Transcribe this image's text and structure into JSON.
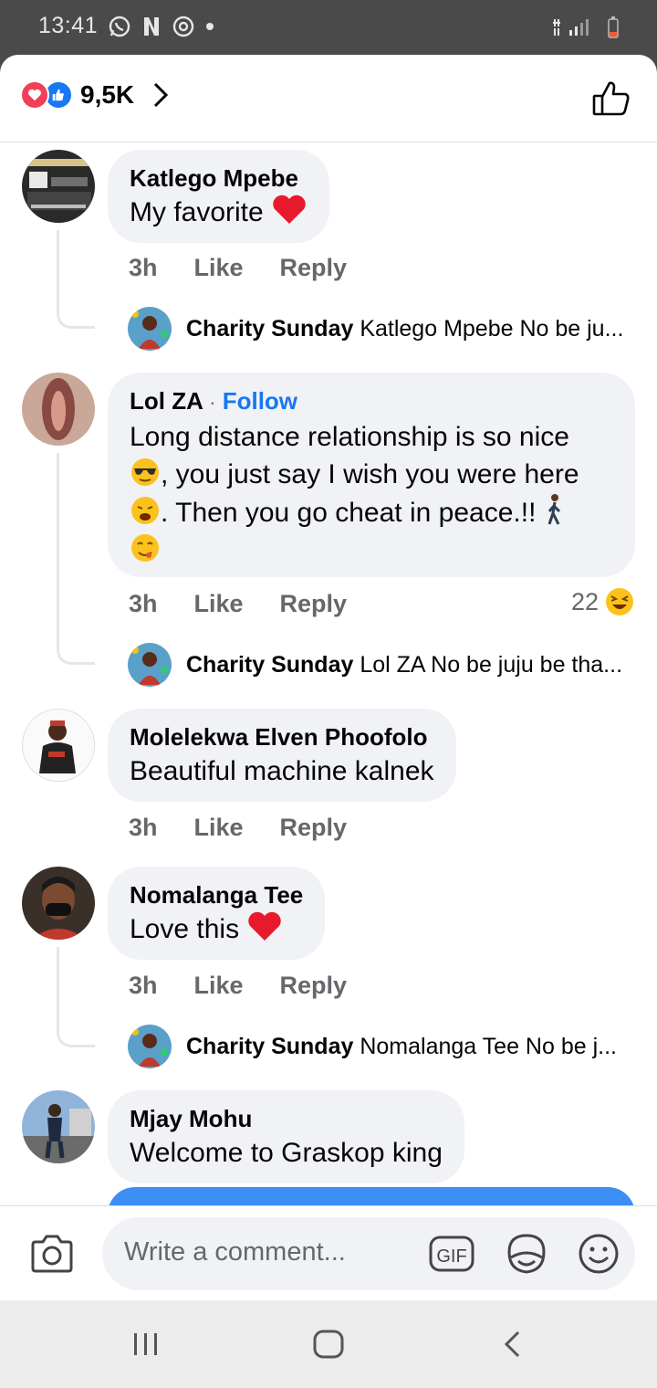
{
  "status_bar": {
    "time": "13:41"
  },
  "header": {
    "reaction_count": "9,5K"
  },
  "comments": [
    {
      "author": "Katlego Mpebe",
      "text": "My favorite",
      "time": "3h",
      "like": "Like",
      "reply": "Reply",
      "replies": [
        {
          "author": "Charity Sunday",
          "text": "Katlego Mpebe No be ju..."
        }
      ]
    },
    {
      "author": "Lol ZA",
      "follow_sep": "·",
      "follow": "Follow",
      "text_line1": "Long distance relationship is so nice",
      "text_line2": ", you just say I wish you were here",
      "text_line3": ". Then you go cheat in peace.!!",
      "time": "3h",
      "like": "Like",
      "reply": "Reply",
      "reactions": "22",
      "replies": [
        {
          "author": "Charity Sunday",
          "text": "Lol ZA No be juju be tha..."
        }
      ]
    },
    {
      "author": "Molelekwa Elven Phoofolo",
      "text": "Beautiful machine kalnek",
      "time": "3h",
      "like": "Like",
      "reply": "Reply"
    },
    {
      "author": "Nomalanga Tee",
      "text": "Love this",
      "time": "3h",
      "like": "Like",
      "reply": "Reply",
      "replies": [
        {
          "author": "Charity Sunday",
          "text": "Nomalanga Tee No be j..."
        }
      ]
    },
    {
      "author": "Mjay Mohu",
      "text": "Welcome to Graskop king"
    }
  ],
  "composer": {
    "placeholder": "Write a comment...",
    "gif_label": "GIF"
  },
  "colors": {
    "accent": "#1877f2",
    "heart": "#f33e58",
    "bubble": "#f0f2f5",
    "meta": "#65676b"
  }
}
